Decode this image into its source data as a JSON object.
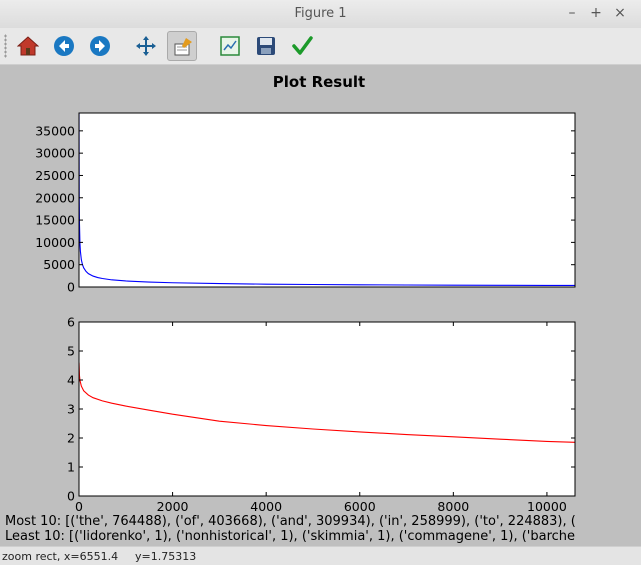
{
  "window": {
    "title": "Figure 1",
    "minimize": "–",
    "maximize": "+",
    "close": "×"
  },
  "toolbar": {
    "buttons": [
      {
        "name": "home-icon",
        "tooltip": "Home"
      },
      {
        "name": "back-icon",
        "tooltip": "Back"
      },
      {
        "name": "forward-icon",
        "tooltip": "Forward"
      },
      {
        "name": "pan-icon",
        "tooltip": "Pan"
      },
      {
        "name": "zoom-icon",
        "tooltip": "Zoom",
        "active": true
      },
      {
        "name": "subplots-icon",
        "tooltip": "Configure subplots"
      },
      {
        "name": "save-icon",
        "tooltip": "Save"
      },
      {
        "name": "edit-icon",
        "tooltip": "Edit parameters"
      }
    ]
  },
  "figure": {
    "title": "Plot Result",
    "most_text": "Most 10: [('the', 764488), ('of', 403668), ('and', 309934), ('in', 258999), ('to', 224883), (",
    "least_text": "Least 10: [('lidorenko', 1), ('nonhistorical', 1), ('skimmia', 1), ('commagene', 1), ('barche"
  },
  "chart_data": [
    {
      "type": "line",
      "title": "Plot Result",
      "xlim": [
        0,
        10600
      ],
      "ylim": [
        0,
        39000
      ],
      "x_ticks": [],
      "y_ticks": [
        0,
        5000,
        10000,
        15000,
        20000,
        25000,
        30000,
        35000
      ],
      "y_tick_labels": [
        "0",
        "5000",
        "10000",
        "15000",
        "20000",
        "25000",
        "30000",
        "35000"
      ],
      "grid": false,
      "series": [
        {
          "color": "#0000ff",
          "x": [
            1,
            5,
            10,
            20,
            30,
            50,
            75,
            100,
            150,
            200,
            300,
            400,
            500,
            700,
            1000,
            1500,
            2000,
            3000,
            4000,
            5000,
            6000,
            7000,
            8000,
            9000,
            10000,
            10600
          ],
          "y": [
            39000,
            20500,
            14200,
            9800,
            8000,
            6100,
            5000,
            4300,
            3500,
            3000,
            2450,
            2120,
            1900,
            1600,
            1350,
            1100,
            950,
            760,
            640,
            560,
            500,
            450,
            410,
            380,
            350,
            340
          ]
        }
      ]
    },
    {
      "type": "line",
      "xlim": [
        0,
        10600
      ],
      "ylim": [
        0,
        6
      ],
      "x_ticks": [
        0,
        2000,
        4000,
        6000,
        8000,
        10000
      ],
      "x_tick_labels": [
        "0",
        "2000",
        "4000",
        "6000",
        "8000",
        "10000"
      ],
      "y_ticks": [
        0,
        1,
        2,
        3,
        4,
        5,
        6
      ],
      "y_tick_labels": [
        "0",
        "1",
        "2",
        "3",
        "4",
        "5",
        "6"
      ],
      "grid": false,
      "series": [
        {
          "color": "#ff0000",
          "x": [
            1,
            10,
            20,
            50,
            100,
            200,
            300,
            500,
            700,
            1000,
            1500,
            2000,
            3000,
            4000,
            5000,
            6000,
            7000,
            8000,
            9000,
            10000,
            10600
          ],
          "y": [
            4.6,
            4.15,
            3.99,
            3.79,
            3.63,
            3.48,
            3.39,
            3.28,
            3.2,
            3.1,
            2.96,
            2.82,
            2.58,
            2.43,
            2.31,
            2.21,
            2.12,
            2.04,
            1.96,
            1.88,
            1.85
          ]
        }
      ]
    }
  ],
  "status": {
    "mode": "zoom rect, x=6551.4",
    "y": "y=1.75313"
  }
}
